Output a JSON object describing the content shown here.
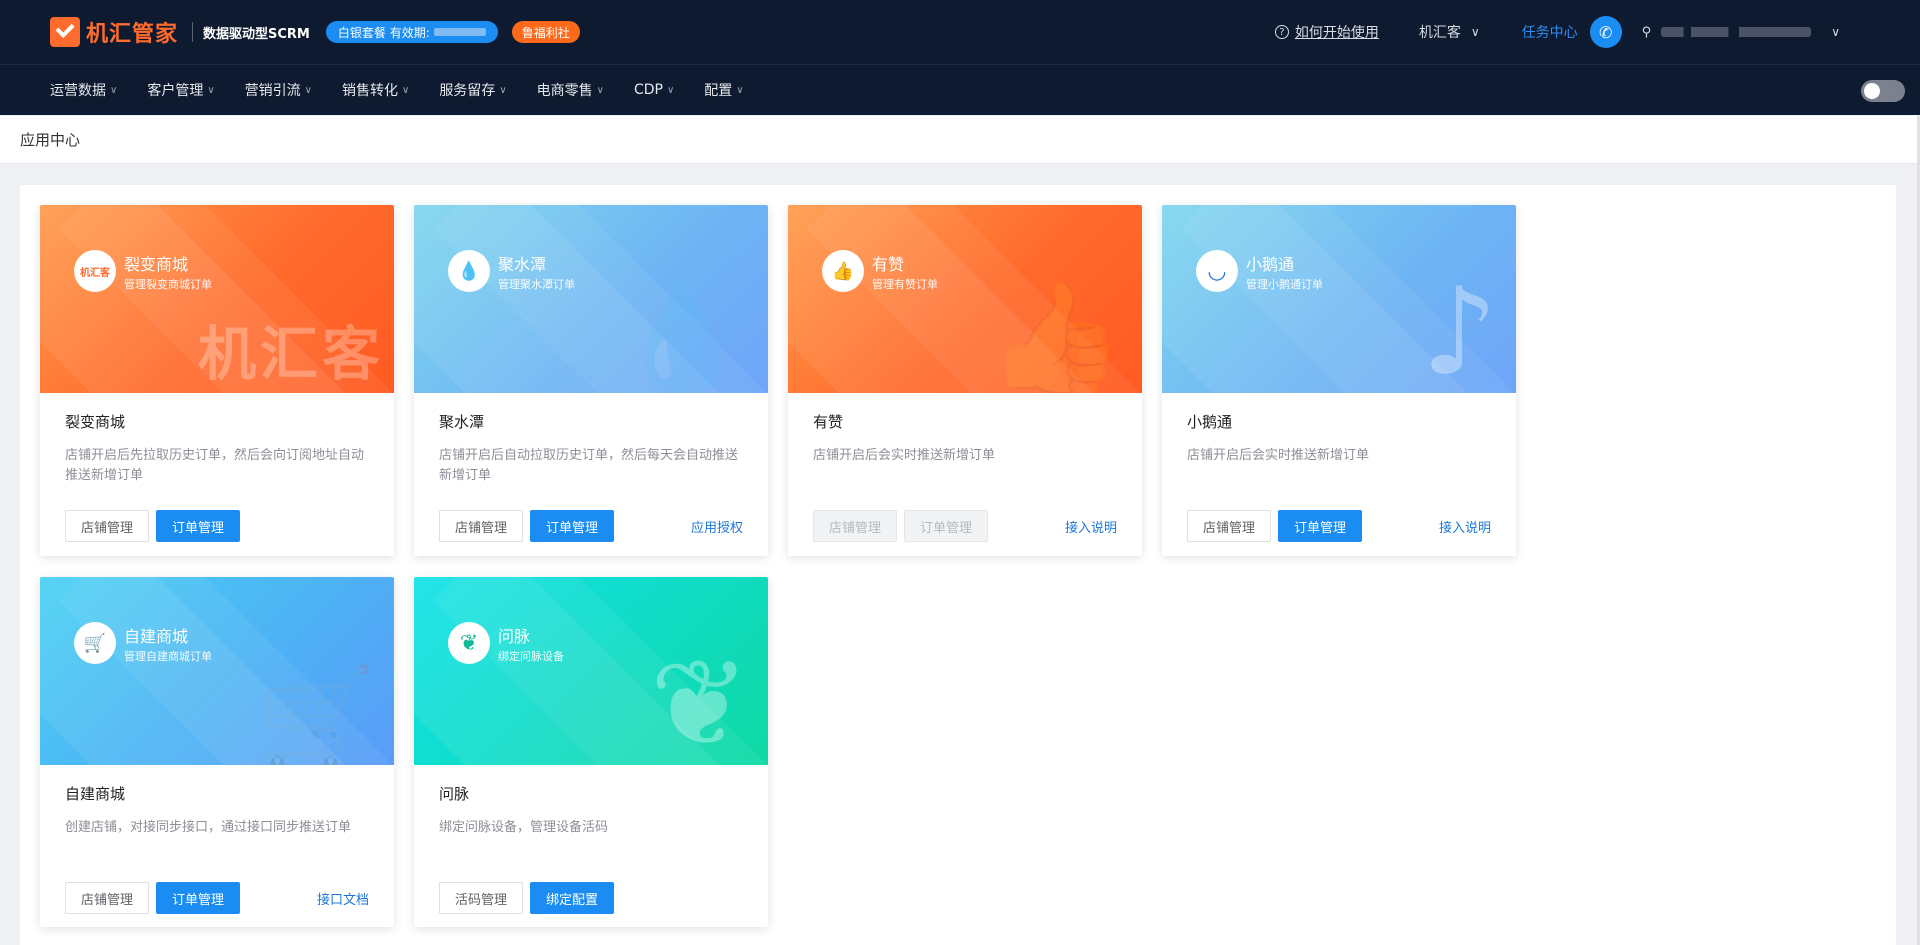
{
  "header": {
    "logo_text": "机汇管家",
    "tagline": "数据驱动型SCRM",
    "plan_badge": "白银套餐 有效期:",
    "welfare_badge": "鲁福利社",
    "help_link": "如何开始使用",
    "brand_selector": "机汇客",
    "task_center": "任务中心",
    "colors": {
      "background": "#0e1a2f",
      "brand_orange": "#ff6b2c",
      "accent_blue": "#1b8cf2"
    }
  },
  "nav": {
    "items": [
      {
        "label": "运营数据"
      },
      {
        "label": "客户管理"
      },
      {
        "label": "营销引流"
      },
      {
        "label": "销售转化"
      },
      {
        "label": "服务留存"
      },
      {
        "label": "电商零售"
      },
      {
        "label": "CDP"
      },
      {
        "label": "配置"
      }
    ]
  },
  "breadcrumb": {
    "title": "应用中心"
  },
  "cards": [
    {
      "banner_title": "裂变商城",
      "banner_sub": "管理裂变商城订单",
      "icon_text": "机汇客",
      "watermark": "机汇客",
      "title": "裂变商城",
      "desc": "店铺开启后先拉取历史订单，然后会向订阅地址自动推送新增订单",
      "buttons": [
        {
          "label": "店铺管理",
          "style": "default"
        },
        {
          "label": "订单管理",
          "style": "primary"
        }
      ],
      "link": ""
    },
    {
      "banner_title": "聚水潭",
      "banner_sub": "管理聚水潭订单",
      "icon_glyph": "💧",
      "deco": "💧",
      "title": "聚水潭",
      "desc": "店铺开启后自动拉取历史订单，然后每天会自动推送新增订单",
      "buttons": [
        {
          "label": "店铺管理",
          "style": "default"
        },
        {
          "label": "订单管理",
          "style": "primary"
        }
      ],
      "link": "应用授权"
    },
    {
      "banner_title": "有赞",
      "banner_sub": "管理有赞订单",
      "icon_glyph": "👍",
      "deco": "👍",
      "title": "有赞",
      "desc": "店铺开启后会实时推送新增订单",
      "buttons": [
        {
          "label": "店铺管理",
          "style": "disabled"
        },
        {
          "label": "订单管理",
          "style": "disabled"
        }
      ],
      "link": "接入说明"
    },
    {
      "banner_title": "小鹅通",
      "banner_sub": "管理小鹅通订单",
      "icon_glyph": "◡",
      "deco": "♪",
      "title": "小鹅通",
      "desc": "店铺开启后会实时推送新增订单",
      "buttons": [
        {
          "label": "店铺管理",
          "style": "default"
        },
        {
          "label": "订单管理",
          "style": "primary"
        }
      ],
      "link": "接入说明"
    },
    {
      "banner_title": "自建商城",
      "banner_sub": "管理自建商城订单",
      "icon_glyph": "🛒",
      "deco": "🛒",
      "title": "自建商城",
      "desc": "创建店铺，对接同步接口，通过接口同步推送订单",
      "buttons": [
        {
          "label": "店铺管理",
          "style": "default"
        },
        {
          "label": "订单管理",
          "style": "primary"
        }
      ],
      "link": "接口文档"
    },
    {
      "banner_title": "问脉",
      "banner_sub": "绑定问脉设备",
      "icon_glyph": "❦",
      "deco": "❦",
      "title": "问脉",
      "desc": "绑定问脉设备，管理设备活码",
      "buttons": [
        {
          "label": "活码管理",
          "style": "default"
        },
        {
          "label": "绑定配置",
          "style": "primary"
        }
      ],
      "link": ""
    }
  ]
}
